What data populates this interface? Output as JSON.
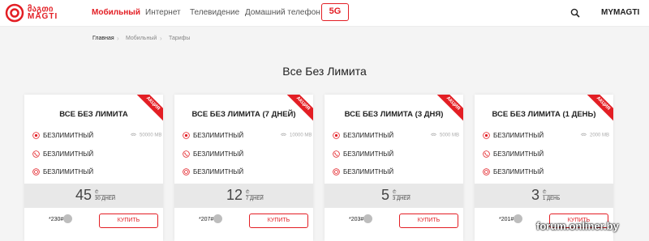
{
  "brand": {
    "logo_line1": "მაგთი",
    "logo_line2": "MAGTI",
    "accent": "#e31e24"
  },
  "nav": {
    "items": [
      "Мобильный",
      "Интернет",
      "Телевидение",
      "Домашний телефон"
    ],
    "badge_5g": "5G",
    "account": "MYMAGTI"
  },
  "breadcrumb": [
    "Главная",
    "Мобильный",
    "Тарифы"
  ],
  "page_title": "Все Без Лимита",
  "cards": [
    {
      "ribbon": "АКЦИЯ",
      "title": "ВСЕ БЕЗ ЛИМИТА",
      "features": [
        "БЕЗЛИМИТНЫЙ",
        "БЕЗЛИМИТНЫЙ",
        "БЕЗЛИМИТНЫЙ"
      ],
      "data": "50000 MB",
      "price": "45",
      "currency": "₾",
      "period": "30 ДНЕЙ",
      "code": "*230#",
      "buy": "КУПИТЬ"
    },
    {
      "ribbon": "АКЦИЯ",
      "title": "ВСЕ БЕЗ ЛИМИТА (7 ДНЕЙ)",
      "features": [
        "БЕЗЛИМИТНЫЙ",
        "БЕЗЛИМИТНЫЙ",
        "БЕЗЛИМИТНЫЙ"
      ],
      "data": "10000 MB",
      "price": "12",
      "currency": "₾",
      "period": "7 ДНЕЙ",
      "code": "*207#",
      "buy": "КУПИТЬ"
    },
    {
      "ribbon": "АКЦИЯ",
      "title": "ВСЕ БЕЗ ЛИМИТА (3 ДНЯ)",
      "features": [
        "БЕЗЛИМИТНЫЙ",
        "БЕЗЛИМИТНЫЙ",
        "БЕЗЛИМИТНЫЙ"
      ],
      "data": "5000 MB",
      "price": "5",
      "currency": "₾",
      "period": "3 ДНЕЙ",
      "code": "*203#",
      "buy": "КУПИТЬ"
    },
    {
      "ribbon": "АКЦИЯ",
      "title": "ВСЕ БЕЗ ЛИМИТА (1 ДЕНЬ)",
      "features": [
        "БЕЗЛИМИТНЫЙ",
        "БЕЗЛИМИТНЫЙ",
        "БЕЗЛИМИТНЫЙ"
      ],
      "data": "2000 MB",
      "price": "3",
      "currency": "₾",
      "period": "1 ДЕНЬ",
      "code": "*201#",
      "buy": "КУПИТЬ"
    }
  ],
  "watermark": "forum.onliner.by",
  "icons": {
    "feature_icons": [
      "globe-icon",
      "phone-icon",
      "sms-icon"
    ],
    "data_icon": "wifi-icon",
    "search": "search-icon",
    "code_badge": "phone-icon"
  }
}
